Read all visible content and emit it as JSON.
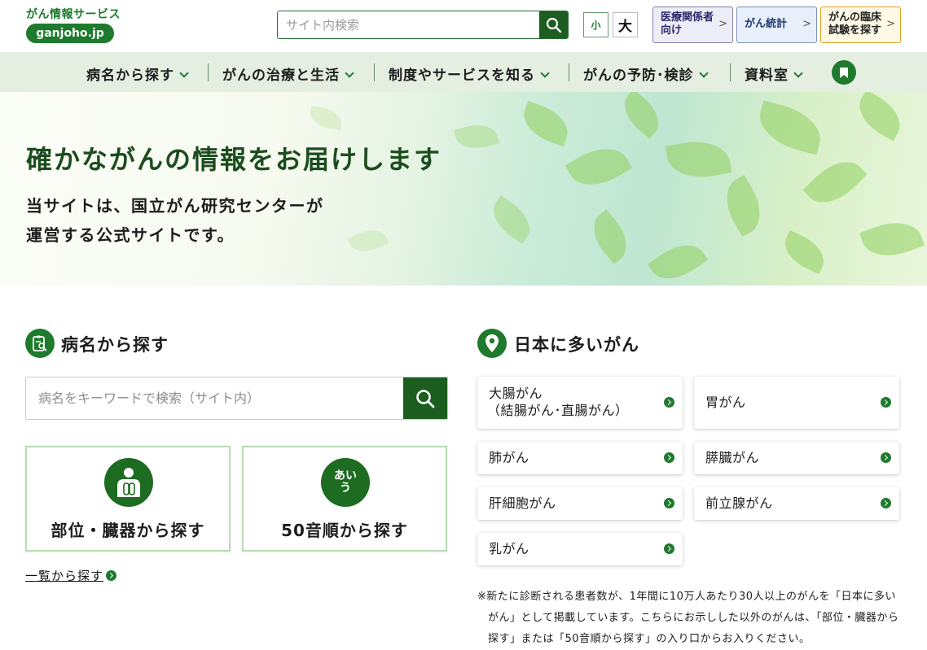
{
  "header": {
    "logo_title": "がん情報サービス",
    "logo_domain": "ganjoho.jp",
    "search_placeholder": "サイト内検索",
    "font_small": "小",
    "font_large": "大",
    "links": [
      {
        "line1": "医療関係者",
        "line2": "向け"
      },
      {
        "line1": "がん統計",
        "line2": ""
      },
      {
        "line1": "がんの臨床",
        "line2": "試験を探す"
      }
    ]
  },
  "nav": {
    "items": [
      "病名から探す",
      "がんの治療と生活",
      "制度やサービスを知る",
      "がんの予防･検診",
      "資料室"
    ]
  },
  "hero": {
    "title": "確かながんの情報をお届けします",
    "sub_line1": "当サイトは、国立がん研究センターが",
    "sub_line2": "運営する公式サイトです。"
  },
  "disease_search": {
    "title": "病名から探す",
    "placeholder": "病名をキーワードで検索（サイト内）",
    "card_body": "部位・臓器から探す",
    "card_kana": "50音順から探す",
    "kana_icon_text": "あいう",
    "list_link": "一覧から探す"
  },
  "common_cancers": {
    "title": "日本に多いがん",
    "items": [
      {
        "line1": "大腸がん",
        "line2": "（結腸がん･直腸がん）"
      },
      {
        "line1": "胃がん",
        "line2": ""
      },
      {
        "line1": "肺がん",
        "line2": ""
      },
      {
        "line1": "膵臓がん",
        "line2": ""
      },
      {
        "line1": "肝細胞がん",
        "line2": ""
      },
      {
        "line1": "前立腺がん",
        "line2": ""
      },
      {
        "line1": "乳がん",
        "line2": ""
      }
    ],
    "note": "※新たに診断される患者数が、1年間に10万人あたり30人以上のがんを「日本に多いがん」として掲載しています。こちらにお示しした以外のがんは、「部位・臓器から探す」または「50音順から探す」の入り口からお入りください。"
  },
  "colors": {
    "brand_green": "#1e7a2c",
    "dark_green": "#1b5e20",
    "nav_bg": "#e4efe2"
  }
}
